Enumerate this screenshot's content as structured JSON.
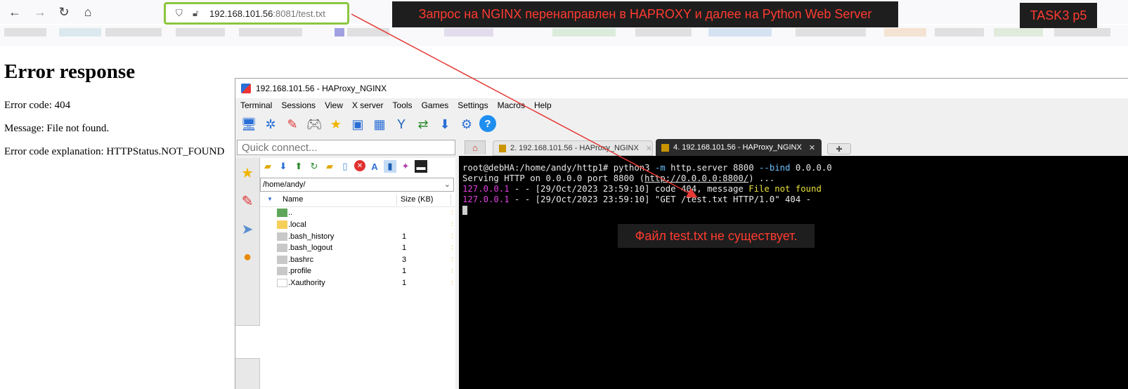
{
  "browser": {
    "url_host": "192.168.101.56",
    "url_path": ":8081/test.txt"
  },
  "annotations": {
    "main": "Запрос на NGINX перенаправлен в HAPROXY  и далее на Python Web Server",
    "task": "TASK3 p5",
    "terminal": "Файл test.txt не существует."
  },
  "error_page": {
    "title": "Error response",
    "code": "Error code: 404",
    "message": "Message: File not found.",
    "explanation": "Error code explanation: HTTPStatus.NOT_FOUND"
  },
  "moba": {
    "title": "192.168.101.56 - HAProxy_NGINX",
    "menu": [
      "Terminal",
      "Sessions",
      "View",
      "X server",
      "Tools",
      "Games",
      "Settings",
      "Macros",
      "Help"
    ],
    "quick_connect_placeholder": "Quick connect...",
    "path": "/home/andy/",
    "col_name": "Name",
    "col_size": "Size (KB)",
    "files": [
      {
        "name": "..",
        "size": ""
      },
      {
        "name": ".local",
        "size": ""
      },
      {
        "name": ".bash_history",
        "size": "1"
      },
      {
        "name": ".bash_logout",
        "size": "1"
      },
      {
        "name": ".bashrc",
        "size": "3"
      },
      {
        "name": ".profile",
        "size": "1"
      },
      {
        "name": ".Xauthority",
        "size": "1"
      }
    ],
    "tabs": [
      {
        "label": "2. 192.168.101.56 - HAProxy_NGINX"
      },
      {
        "label": "4. 192.168.101.56 - HAProxy_NGINX"
      }
    ]
  },
  "terminal": {
    "prompt": "root@debHA:/home/andy/http1# ",
    "cmd_a": "python3 ",
    "cmd_flag1": "-m",
    "cmd_b": " http.server 8800 ",
    "cmd_flag2": "--bind",
    "cmd_c": " 0.0.0.0",
    "serving_a": "Serving HTTP on 0.0.0.0 port 8800 (",
    "serving_link": "http://0.0.0.0:8800/",
    "serving_b": ") ...",
    "log1_ip": "127.0.0.1",
    "log1_mid": " - - [29/Oct/2023 23:59:10] code 404, message ",
    "log1_msg": "File not found",
    "log2_ip": "127.0.0.1",
    "log2_rest": " - - [29/Oct/2023 23:59:10] \"GET /test.txt HTTP/1.0\" 404 -"
  },
  "colors": {
    "annotation_red": "#ff3b30",
    "urlbar_border": "#8cc63f",
    "terminal_bg": "#000000"
  }
}
